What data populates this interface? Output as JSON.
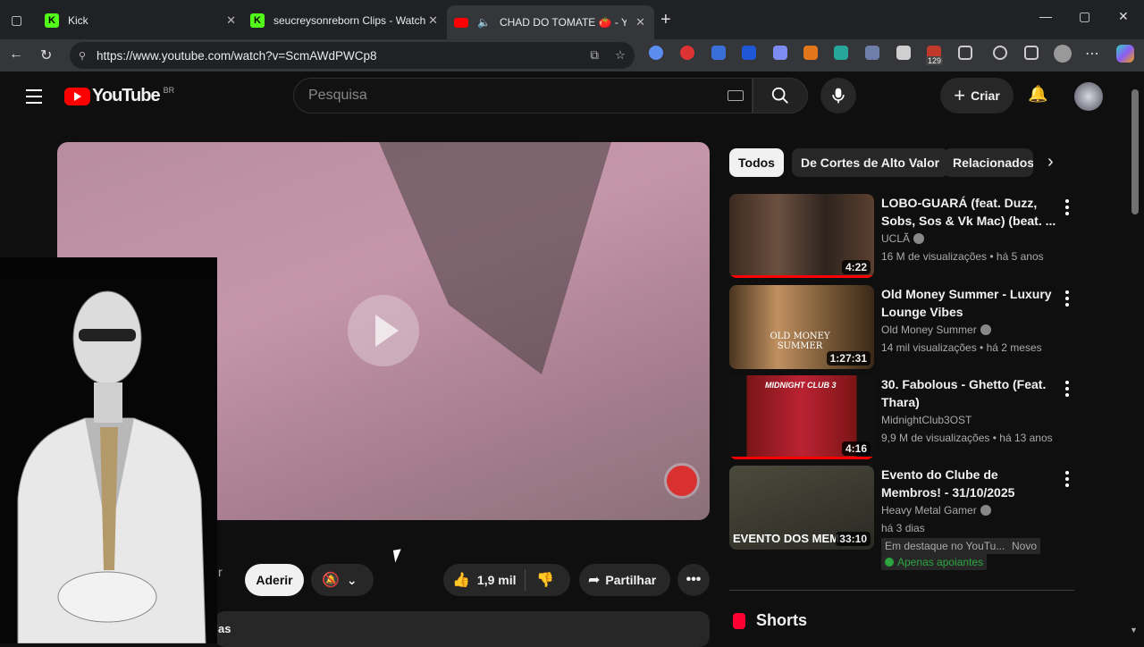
{
  "browser": {
    "tabs": [
      {
        "title": "Kick"
      },
      {
        "title": "seucreysonreborn Clips - Watch L"
      },
      {
        "title": "CHAD DO TOMATE 🍅 - You"
      }
    ],
    "url": "https://www.youtube.com/watch?v=ScmAWdPWCp8",
    "ext_badge": "129"
  },
  "youtube": {
    "logo_text": "YouTube",
    "country_code": "BR",
    "search_placeholder": "Pesquisa",
    "create_label": "Criar"
  },
  "video_actions": {
    "join_label": "Aderir",
    "likes": "1,9 mil",
    "share_label": "Partilhar",
    "partial_left_text": "r",
    "partial_bottom_text": "as"
  },
  "chips": [
    "Todos",
    "De Cortes de Alto Valor",
    "Relacionados"
  ],
  "recommendations": [
    {
      "title": "LOBO-GUARÁ (feat. Duzz, Sobs, Sos & Vk Mac) (beat. ...",
      "channel": "UCLÃ",
      "verified": true,
      "meta": "16 M de visualizações • há 5 anos",
      "duration": "4:22",
      "watched": true,
      "thumb_color": "#5a4a3c"
    },
    {
      "title": "Old Money Summer - Luxury Lounge Vibes",
      "channel": "Old Money Summer",
      "verified": true,
      "meta": "14 mil visualizações • há 2 meses",
      "duration": "1:27:31",
      "watched": false,
      "thumb_overlay": "OLD MONEY SUMMER",
      "thumb_color": "#b08850"
    },
    {
      "title": "30. Fabolous - Ghetto (Feat. Thara)",
      "channel": "MidnightClub3OST",
      "verified": false,
      "meta": "9,9 M de visualizações • há 13 anos",
      "duration": "4:16",
      "watched": true,
      "thumb_overlay": "MIDNIGHT CLUB 3",
      "thumb_color": "#7a1515"
    },
    {
      "title": "Evento do Clube de Membros! - 31/10/2025",
      "channel": "Heavy Metal Gamer",
      "verified": true,
      "meta": "há 3 dias",
      "duration": "33:10",
      "watched": false,
      "thumb_overlay": "EVENTO DOS MEM",
      "thumb_color": "#3a3a30",
      "badges": [
        "Em destaque no YouTu...",
        "Novo"
      ],
      "members_label": "Apenas apoiantes"
    }
  ],
  "shorts_label": "Shorts"
}
